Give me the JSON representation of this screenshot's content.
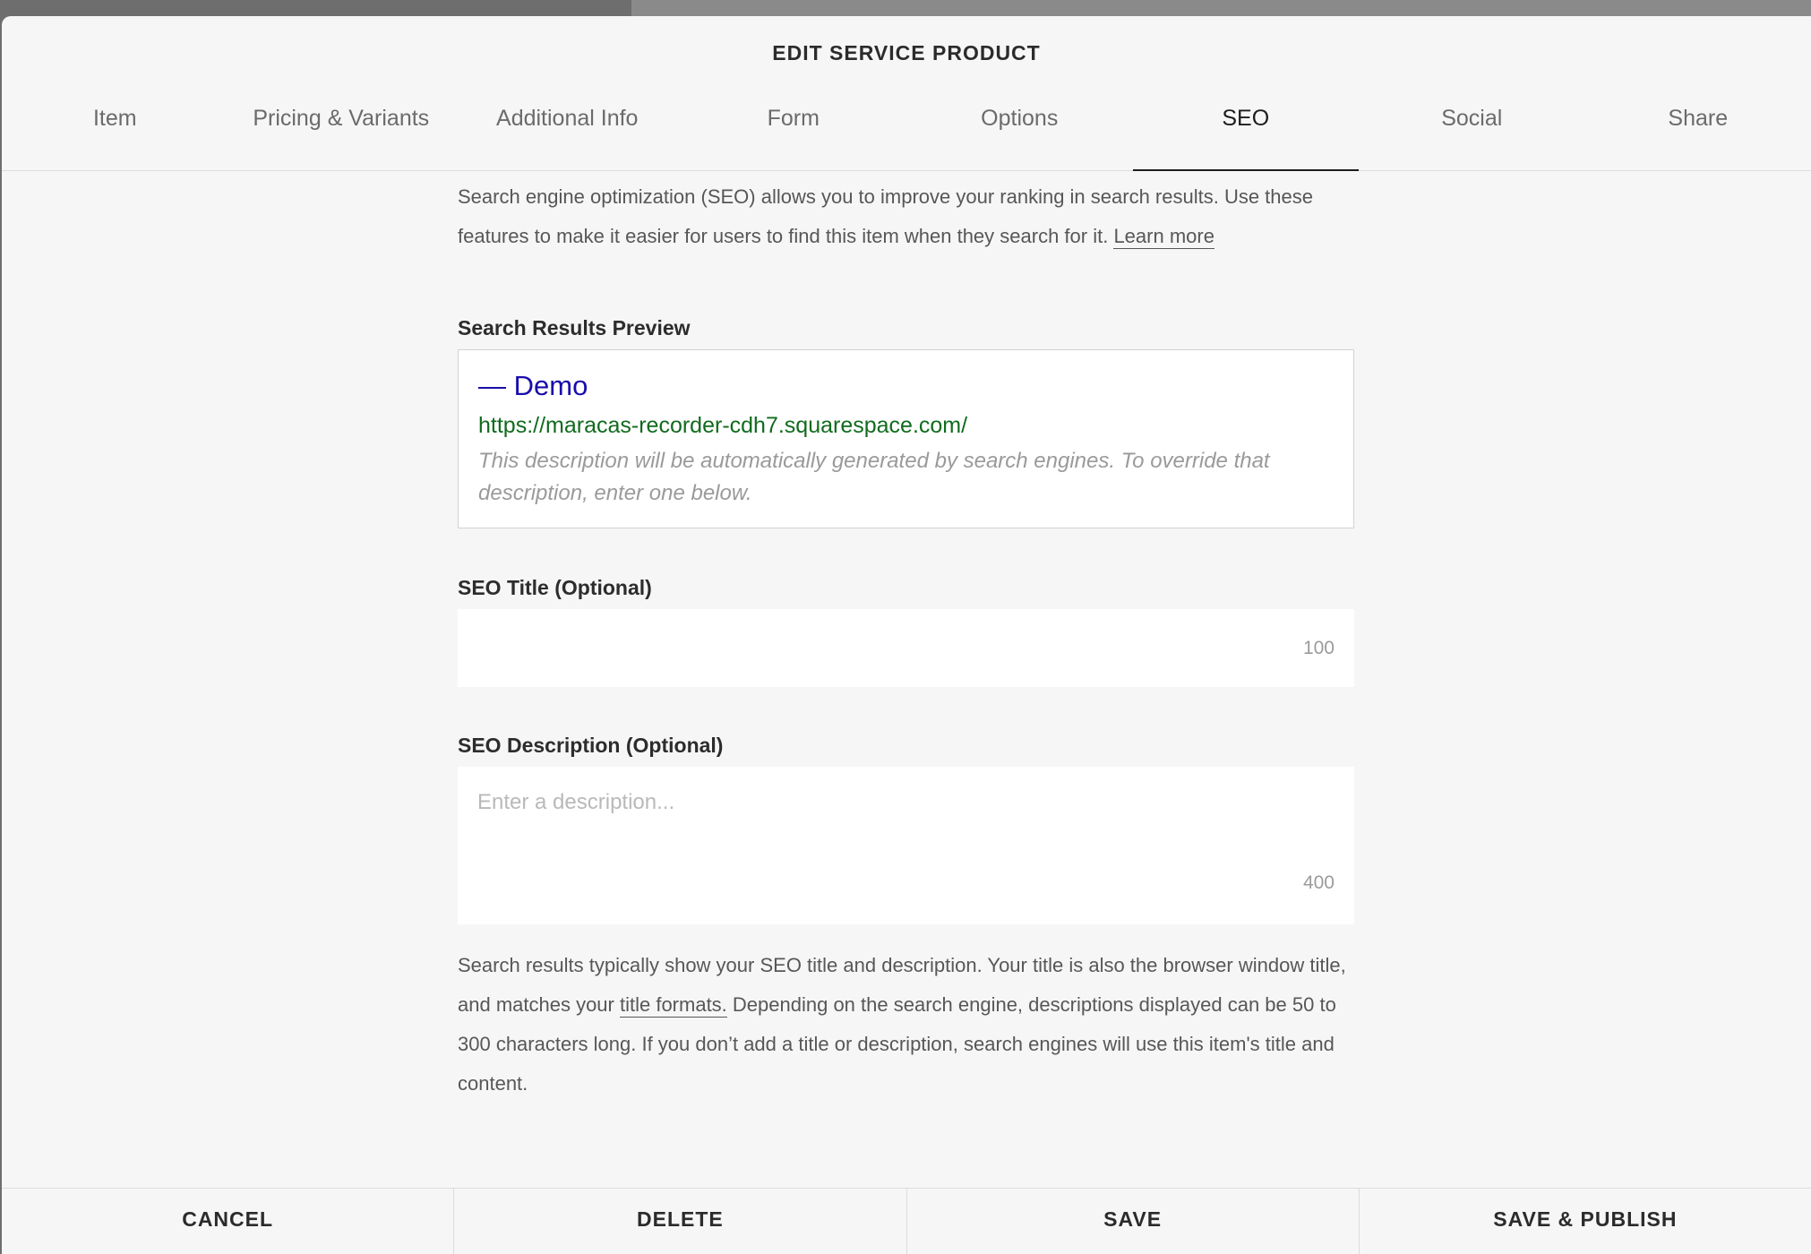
{
  "modal": {
    "title": "EDIT SERVICE PRODUCT"
  },
  "tabs": [
    {
      "label": "Item"
    },
    {
      "label": "Pricing & Variants"
    },
    {
      "label": "Additional Info"
    },
    {
      "label": "Form"
    },
    {
      "label": "Options"
    },
    {
      "label": "SEO"
    },
    {
      "label": "Social"
    },
    {
      "label": "Share"
    }
  ],
  "active_tab": "SEO",
  "intro": {
    "text": "Search engine optimization (SEO) allows you to improve your ranking in search results. Use these features to make it easier for users to find this item when they search for it. ",
    "link": "Learn more"
  },
  "preview": {
    "label": "Search Results Preview",
    "title": "— Demo",
    "url": "https://maracas-recorder-cdh7.squarespace.com/",
    "description": "This description will be automatically generated by search engines. To override that description, enter one below."
  },
  "seo_title": {
    "label": "SEO Title (Optional)",
    "value": "",
    "counter": "100"
  },
  "seo_description": {
    "label": "SEO Description (Optional)",
    "value": "",
    "placeholder": "Enter a description...",
    "counter": "400"
  },
  "footer_note": {
    "before": "Search results typically show your SEO title and description. Your title is also the browser window title, and matches your ",
    "link": "title formats.",
    "after": " Depending on the search engine, descriptions displayed can be 50 to 300 characters long. If you don’t add a title or description, search engines will use this item's title and content."
  },
  "footer": {
    "cancel": "CANCEL",
    "delete": "DELETE",
    "save": "SAVE",
    "save_publish": "SAVE & PUBLISH"
  },
  "colors": {
    "preview_title": "#1a0dab",
    "preview_url": "#116b1e",
    "modal_bg": "#f6f6f6"
  }
}
